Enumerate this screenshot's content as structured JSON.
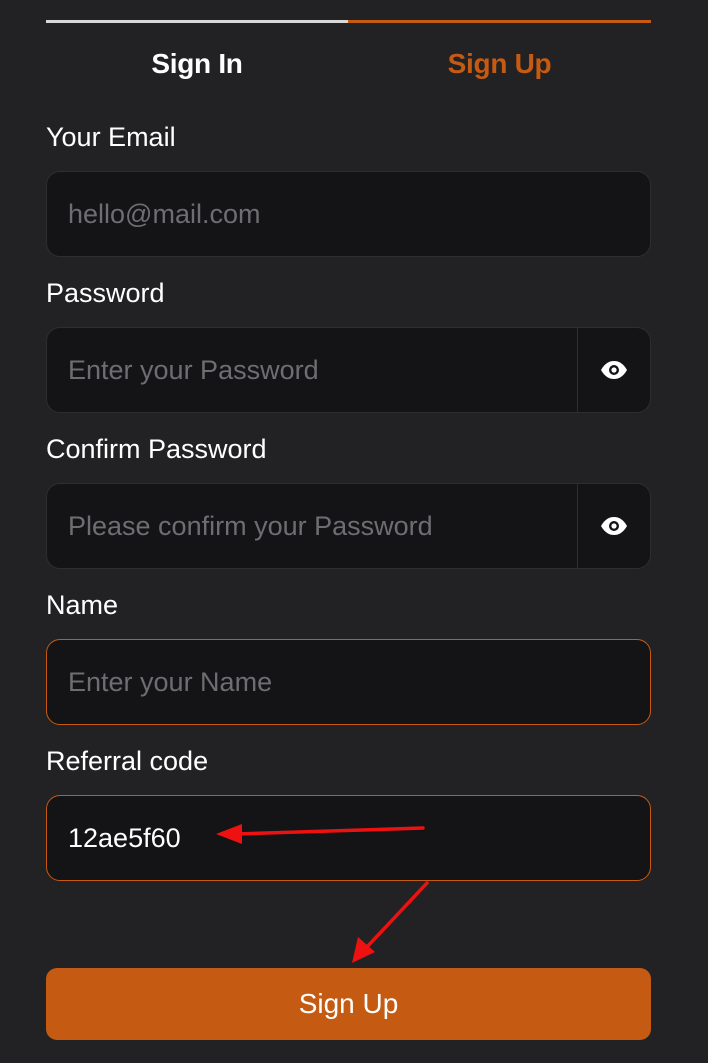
{
  "tabs": {
    "sign_in": "Sign In",
    "sign_up": "Sign Up",
    "active": "sign_up"
  },
  "form": {
    "email": {
      "label": "Your Email",
      "placeholder": "hello@mail.com",
      "value": ""
    },
    "password": {
      "label": "Password",
      "placeholder": "Enter your Password",
      "value": "",
      "toggle_icon": "eye-icon"
    },
    "confirm_password": {
      "label": "Confirm Password",
      "placeholder": "Please confirm your Password",
      "value": "",
      "toggle_icon": "eye-icon"
    },
    "name": {
      "label": "Name",
      "placeholder": "Enter your Name",
      "value": ""
    },
    "referral": {
      "label": "Referral code",
      "value": "12ae5f60"
    }
  },
  "submit_label": "Sign Up",
  "colors": {
    "accent": "#c55a12",
    "background": "#222224",
    "field_bg": "#141416",
    "annotation": "#ee1111"
  }
}
